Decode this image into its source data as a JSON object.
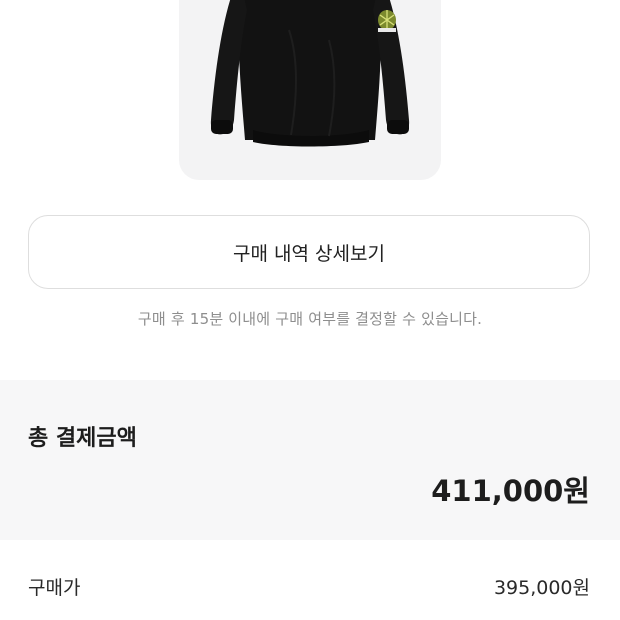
{
  "purchase": {
    "detail_button_label": "구매 내역 상세보기",
    "notice": "구매 후 15분 이내에 구매 여부를 결정할 수 있습니다."
  },
  "payment": {
    "total_label": "총 결제금액",
    "total_amount": "411,000원",
    "rows": [
      {
        "label": "구매가",
        "value": "395,000원"
      }
    ]
  },
  "colors": {
    "card_bg": "#f3f3f4",
    "summary_bg": "#f7f7f8",
    "garment": "#121212",
    "badge": "#7c8a2e"
  }
}
